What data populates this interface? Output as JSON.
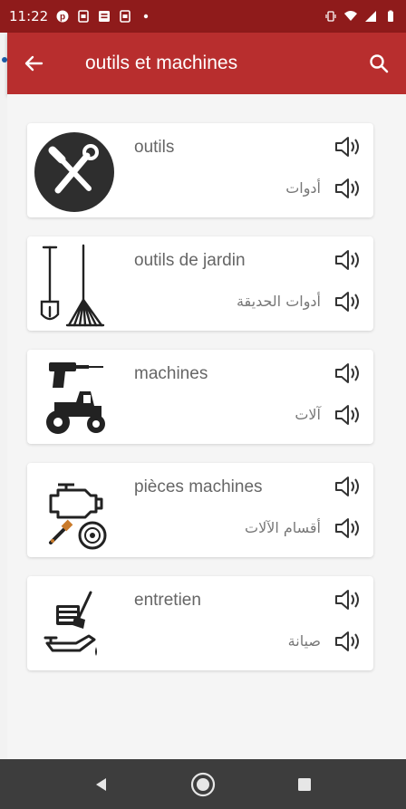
{
  "status_bar": {
    "time": "11:22",
    "bg_color": "#8f1b1b"
  },
  "app_bar": {
    "title": "outils et machines",
    "back_icon": "arrow-left-icon",
    "search_icon": "search-icon",
    "bg_color": "#b82e2e"
  },
  "cards": [
    {
      "french": "outils",
      "arabic": "أدوات",
      "image": "tools-icon"
    },
    {
      "french": "outils de jardin",
      "arabic": "أدوات الحديقة",
      "image": "garden-tools-icon"
    },
    {
      "french": "machines",
      "arabic": "آلات",
      "image": "machines-icon"
    },
    {
      "french": "pièces machines",
      "arabic": "أقسام الآلات",
      "image": "machine-parts-icon"
    },
    {
      "french": "entretien",
      "arabic": "صيانة",
      "image": "maintenance-icon"
    }
  ],
  "nav_bar": {
    "back": "nav-back-icon",
    "home": "nav-home-icon",
    "recents": "nav-recents-icon"
  }
}
